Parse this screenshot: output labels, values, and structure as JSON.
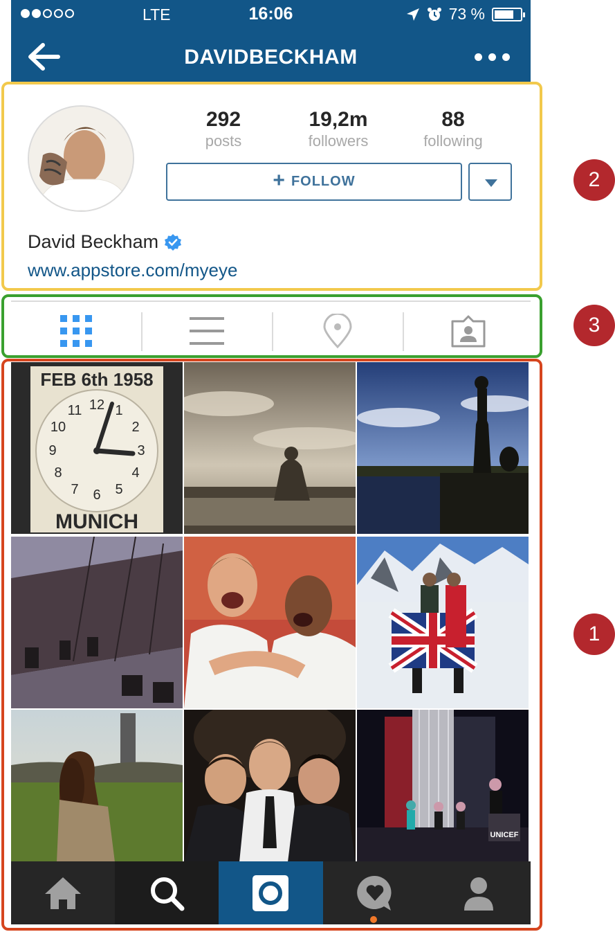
{
  "status_bar": {
    "signal_dots": [
      "filled",
      "filled",
      "empty",
      "empty",
      "empty"
    ],
    "carrier": "LTE",
    "time": "16:06",
    "battery": "73 %",
    "battery_level": 0.73,
    "icons": [
      "location-arrow-icon",
      "alarm-icon",
      "battery-icon"
    ]
  },
  "nav": {
    "title": "DAVIDBECKHAM",
    "back_icon": "back-arrow-icon",
    "more_icon": "more-dots-icon"
  },
  "profile": {
    "stats": [
      {
        "value": "292",
        "label": "posts"
      },
      {
        "value": "19,2m",
        "label": "followers"
      },
      {
        "value": "88",
        "label": "following"
      }
    ],
    "follow_label": "FOLLOW",
    "follow_plus": "+",
    "full_name": "David Beckham",
    "verified": true,
    "website": "www.appstore.com/myeye"
  },
  "tabs": [
    {
      "icon": "grid-view-icon",
      "active": true
    },
    {
      "icon": "list-view-icon",
      "active": false
    },
    {
      "icon": "location-pin-icon",
      "active": false
    },
    {
      "icon": "tagged-photos-icon",
      "active": false
    }
  ],
  "grid": {
    "tiles": [
      {
        "text_top": "FEB 6th 1958",
        "text_bottom": "MUNICH",
        "clock_numbers": [
          "12",
          "1",
          "2",
          "3",
          "4",
          "5",
          "6",
          "7",
          "8",
          "9",
          "10",
          "11"
        ]
      },
      {},
      {},
      {},
      {},
      {},
      {},
      {},
      {
        "sign": "UNICEF"
      }
    ]
  },
  "bottom_nav": [
    {
      "icon": "home-icon"
    },
    {
      "icon": "search-icon"
    },
    {
      "icon": "camera-icon"
    },
    {
      "icon": "activity-heart-icon"
    },
    {
      "icon": "profile-icon"
    }
  ],
  "annotations": {
    "colors": {
      "grid": "#d6451e",
      "header": "#f2c94c",
      "tabs": "#3aa02f",
      "badge": "#b3282d"
    },
    "badges": [
      "1",
      "2",
      "3"
    ]
  }
}
